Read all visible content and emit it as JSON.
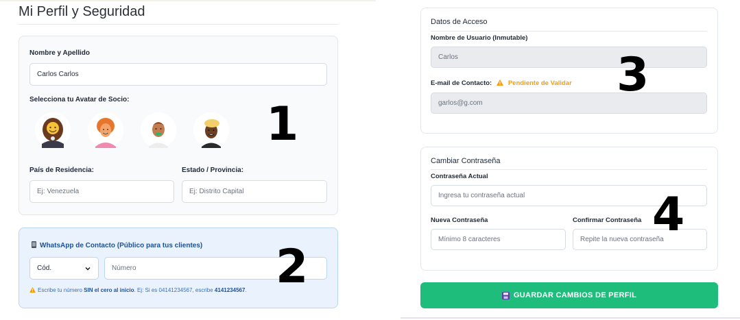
{
  "profile": {
    "title": "Mi Perfil y Seguridad",
    "full_name_label": "Nombre y Apellido",
    "full_name_value": "Carlos Carlos",
    "avatar_label": "Selecciona tu Avatar de Socio:",
    "avatars": [
      "avatar-1",
      "avatar-2",
      "avatar-3",
      "avatar-4"
    ],
    "country_label": "País de Residencia:",
    "country_placeholder": "Ej: Venezuela",
    "state_label": "Estado / Provincia:",
    "state_placeholder": "Ej: Distrito Capital"
  },
  "whatsapp": {
    "title": "WhatsApp de Contacto (Público para tus clientes)",
    "code_selected": "Cód.",
    "number_placeholder": "Número",
    "hint_1": "Escribe tu número ",
    "hint_bold_1": "SIN el cero al inicio",
    "hint_2": ". Ej: Si es 04141234567, escribe ",
    "hint_bold_2": "4141234567",
    "hint_3": "."
  },
  "access": {
    "title": "Datos de Acceso",
    "username_label": "Nombre de Usuario (Inmutable)",
    "username_value": "Carlos",
    "email_label": "E-mail de Contacto:",
    "email_status": "Pendiente de Validar",
    "email_value": "garlos@g.com"
  },
  "password": {
    "title": "Cambiar Contraseña",
    "current_label": "Contraseña Actual",
    "current_placeholder": "Ingresa tu contraseña actual",
    "new_label": "Nueva Contraseña",
    "new_placeholder": "Mínimo 8 caracteres",
    "confirm_label": "Confirmar Contraseña",
    "confirm_placeholder": "Repite la nueva contraseña"
  },
  "save_button": {
    "label": "GUARDAR CAMBIOS DE PERFIL",
    "color": "#1ebd7b"
  },
  "annotations": [
    "1",
    "2",
    "3",
    "4"
  ],
  "colors": {
    "pending": "#f59e0b",
    "whatsapp_bg": "#eaf3fd",
    "hint_text": "#3b6fb6"
  },
  "icons": [
    "warning-icon",
    "phone-icon",
    "floppy-disk-icon",
    "chevron-down-icon"
  ]
}
